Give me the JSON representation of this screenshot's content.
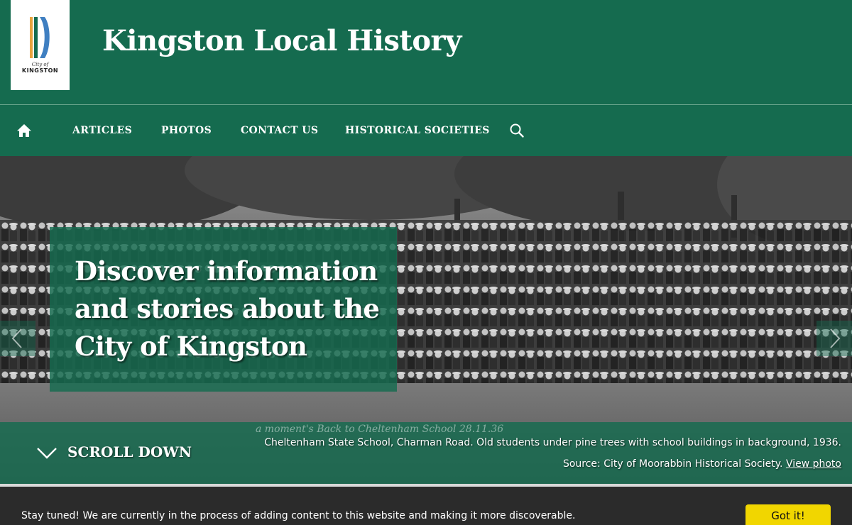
{
  "header": {
    "logo": {
      "small_text": "City of",
      "big_text": "KINGSTON",
      "colors": {
        "orange": "#e8a33d",
        "green": "#156b4f",
        "blue": "#3f7fc1"
      }
    },
    "site_title": "Kingston Local History",
    "background": "#156b4f"
  },
  "nav": {
    "home_icon": "home-icon",
    "items": [
      {
        "label": "ARTICLES"
      },
      {
        "label": "PHOTOS"
      },
      {
        "label": "CONTACT US"
      },
      {
        "label": "HISTORICAL SOCIETIES"
      }
    ],
    "search_icon": "search-icon"
  },
  "hero": {
    "headline": "Discover information and stories about the City of Kingston",
    "handwriting": "a moment's Back to Cheltenham School 28.11.36",
    "scroll_label": "SCROLL DOWN",
    "caption": "Cheltenham State School, Charman Road. Old students under pine trees with school buildings in background, 1936.",
    "source_text": "Source: City of Moorabbin Historical Society.",
    "view_photo_link": "View photo",
    "prev_icon": "chevron-left-icon",
    "next_icon": "chevron-right-icon"
  },
  "cookie_banner": {
    "message": "Stay tuned! We are currently in the process of adding content to this website and making it more discoverable.",
    "button_label": "Got it!",
    "button_color": "#f1d600"
  }
}
